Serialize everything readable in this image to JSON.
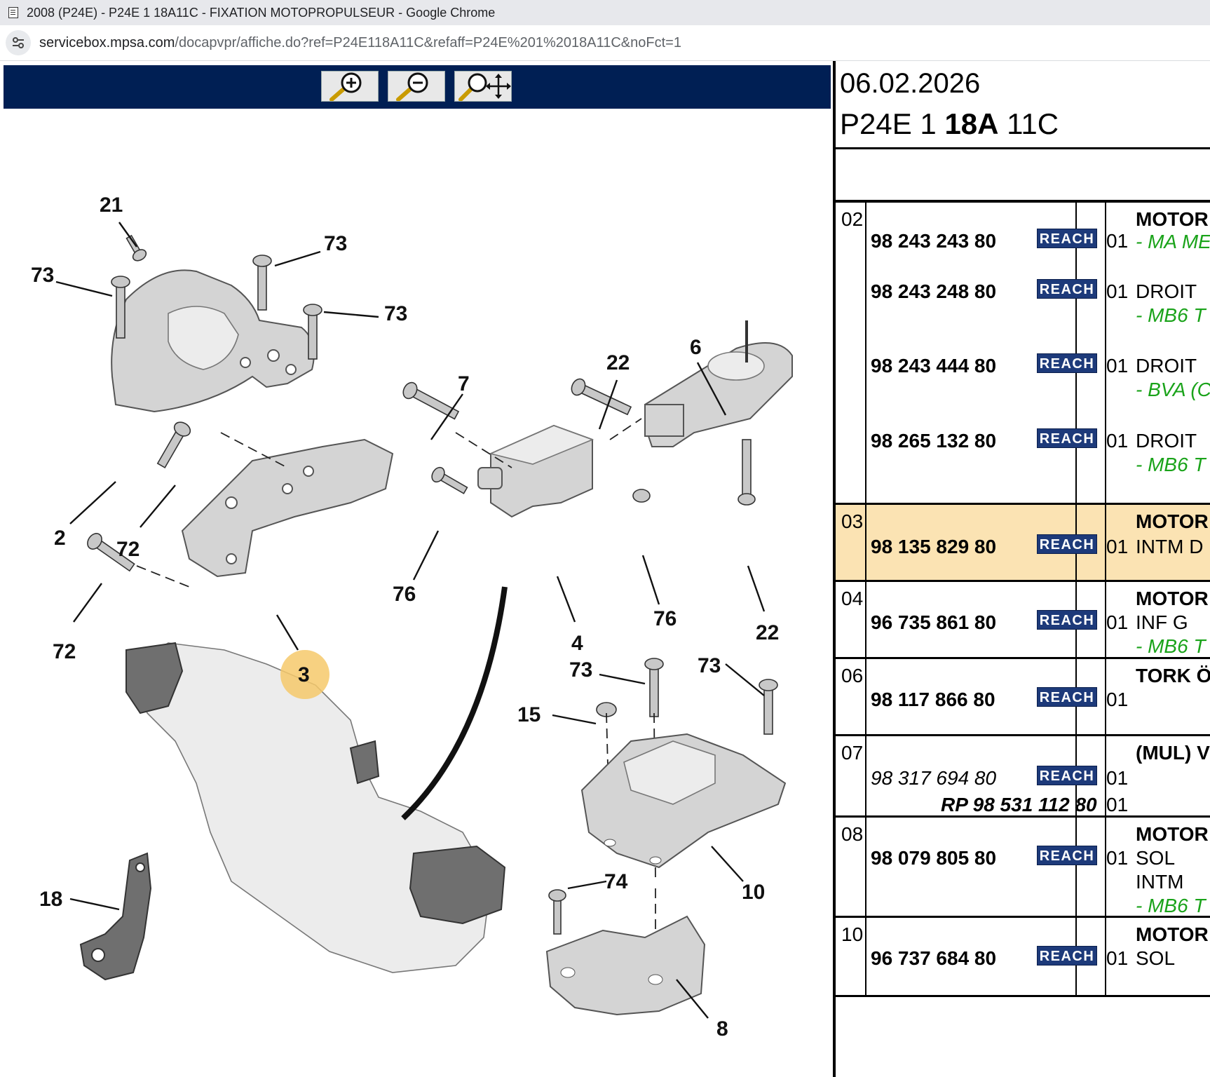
{
  "window": {
    "title": "2008 (P24E) - P24E 1 18A11C - FIXATION MOTOPROPULSEUR - Google Chrome"
  },
  "address": {
    "host": "servicebox.mpsa.com",
    "path": "/docapvpr/affiche.do?ref=P24E118A11C&refaff=P24E%201%2018A11C&noFct=1"
  },
  "toolbar": {
    "zoom_in": "zoom-in-icon",
    "zoom_out": "zoom-out-icon",
    "pan": "zoom-pan-icon"
  },
  "diagram": {
    "callouts": {
      "c21": "21",
      "c73a": "73",
      "c73b": "73",
      "c73c": "73",
      "c2": "2",
      "c72a": "72",
      "c72b": "72",
      "c3": "3",
      "c7": "7",
      "c76a": "76",
      "c4": "4",
      "c22a": "22",
      "c6": "6",
      "c76b": "76",
      "c22b": "22",
      "c73d": "73",
      "c73e": "73",
      "c15": "15",
      "c10": "10",
      "c74": "74",
      "c18": "18",
      "c8": "8"
    },
    "highlight_color": "#f6c96b"
  },
  "sheet": {
    "date": "06.02.2026",
    "ref_a": "P24E 1 ",
    "ref_b": "18A",
    "ref_c": " 11C"
  },
  "rows": [
    {
      "pos": "02",
      "parts": [
        {
          "pn": "98 243 243 80",
          "reach": "REACH",
          "qty": "01",
          "lines": [
            {
              "t": "MOTOR",
              "s": "b"
            },
            {
              "t": "- MA ME",
              "s": "g"
            }
          ]
        },
        {
          "pn": "98 243 248 80",
          "reach": "REACH",
          "qty": "01",
          "lines": [
            {
              "t": "DROIT",
              "s": ""
            },
            {
              "t": "- MB6 T",
              "s": "g"
            }
          ]
        },
        {
          "pn": "98 243 444 80",
          "reach": "REACH",
          "qty": "01",
          "lines": [
            {
              "t": "DROIT",
              "s": ""
            },
            {
              "t": "- BVA (C",
              "s": "g"
            }
          ]
        },
        {
          "pn": "98 265 132 80",
          "reach": "REACH",
          "qty": "01",
          "lines": [
            {
              "t": "DROIT",
              "s": ""
            },
            {
              "t": "- MB6 T",
              "s": "g"
            }
          ]
        }
      ]
    },
    {
      "pos": "03",
      "highlight": true,
      "header": "MOTOR",
      "parts": [
        {
          "pn": "98 135 829 80",
          "reach": "REACH",
          "qty": "01",
          "lines": [
            {
              "t": "INTM D",
              "s": ""
            }
          ]
        }
      ]
    },
    {
      "pos": "04",
      "header": "MOTOR",
      "parts": [
        {
          "pn": "96 735 861 80",
          "reach": "REACH",
          "qty": "01",
          "lines": [
            {
              "t": "INF G",
              "s": ""
            },
            {
              "t": "- MB6 T",
              "s": "g"
            }
          ]
        }
      ]
    },
    {
      "pos": "06",
      "header": "TORK Ö",
      "parts": [
        {
          "pn": "98 117 866 80",
          "reach": "REACH",
          "qty": "01",
          "lines": []
        }
      ]
    },
    {
      "pos": "07",
      "header": "(MUL) V",
      "parts": [
        {
          "pn": "98 317 694 80",
          "alt": true,
          "reach": "REACH",
          "qty": "01",
          "lines": []
        },
        {
          "pn": "RP 98 531 112 80",
          "rp": true,
          "qty": "01",
          "lines": []
        }
      ]
    },
    {
      "pos": "08",
      "header": "MOTOR",
      "parts": [
        {
          "pn": "98 079 805 80",
          "reach": "REACH",
          "qty": "01",
          "lines": [
            {
              "t": "SOL",
              "s": ""
            },
            {
              "t": "INTM",
              "s": ""
            },
            {
              "t": "- MB6 T",
              "s": "g"
            }
          ]
        }
      ]
    },
    {
      "pos": "10",
      "header": "MOTOR",
      "parts": [
        {
          "pn": "96 737 684 80",
          "reach": "REACH",
          "qty": "01",
          "lines": [
            {
              "t": "SOL",
              "s": ""
            }
          ]
        }
      ]
    }
  ]
}
